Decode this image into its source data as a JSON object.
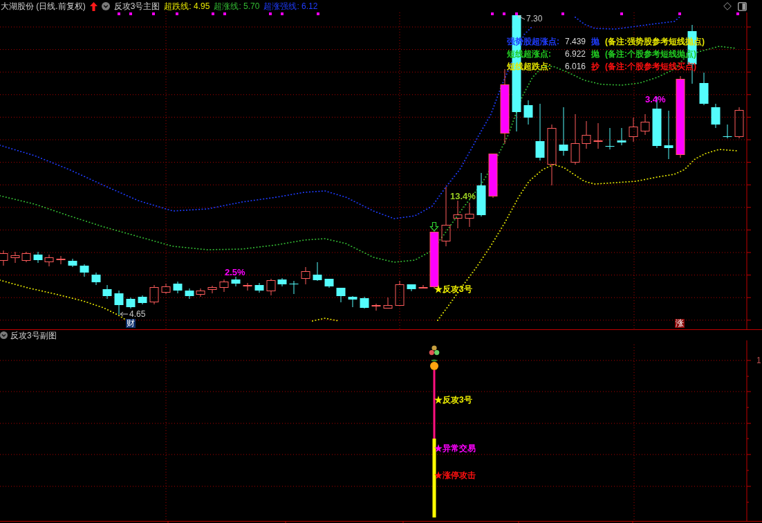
{
  "header": {
    "title": "大湖股份 (日线.前复权)",
    "indicator": "反攻3号主图",
    "legend": [
      {
        "label": "超跌线: 4.95",
        "color": "#e8e800"
      },
      {
        "label": "超涨线: 5.70",
        "color": "#33bb33"
      },
      {
        "label": "超涨强线: 6.12",
        "color": "#1f3cff"
      }
    ]
  },
  "main_chart": {
    "price_markers": [
      {
        "kind": "high",
        "value": "7.30"
      },
      {
        "kind": "low",
        "value": "4.65"
      }
    ],
    "tags": [
      {
        "text": "财",
        "color": "#0c2f6c"
      },
      {
        "text": "涨",
        "color": "#8b0a0a"
      }
    ],
    "change_labels": [
      {
        "text": "2.5%",
        "color": "#ff00ff"
      },
      {
        "text": "13.4%",
        "color": "#99cc22"
      },
      {
        "text": "3.4%",
        "color": "#ff00ff"
      }
    ],
    "signal_label": "★反攻3号",
    "info_panel": [
      {
        "label": {
          "text": "强势股超涨点:",
          "color": "#1f3cff"
        },
        "value": "7.439",
        "action": {
          "text": "抛",
          "color": "#1f3cff"
        },
        "note": {
          "text": "(备注:强势股参考短线抛点)",
          "color": "#e8e800"
        }
      },
      {
        "label": {
          "text": "短线超涨点:",
          "color": "#22cc22"
        },
        "value": "6.922",
        "action": {
          "text": "抛",
          "color": "#22cc22"
        },
        "note": {
          "text": "(备注:个股参考短线抛点)",
          "color": "#22cc22"
        }
      },
      {
        "label": {
          "text": "短线超跌点:",
          "color": "#e8e800"
        },
        "value": "6.016",
        "action": {
          "text": "抄",
          "color": "#ff1010"
        },
        "note": {
          "text": "(备注:个股参考短线买点)",
          "color": "#ff1010"
        }
      }
    ]
  },
  "sub_chart": {
    "title": "反攻3号副图",
    "signals": [
      {
        "text": "★反攻3号",
        "color": "#f0f000"
      },
      {
        "text": "★异常交易",
        "color": "#ff00ff"
      },
      {
        "text": "★涨停攻击",
        "color": "#ff1010"
      }
    ],
    "axis_label": "1"
  }
}
